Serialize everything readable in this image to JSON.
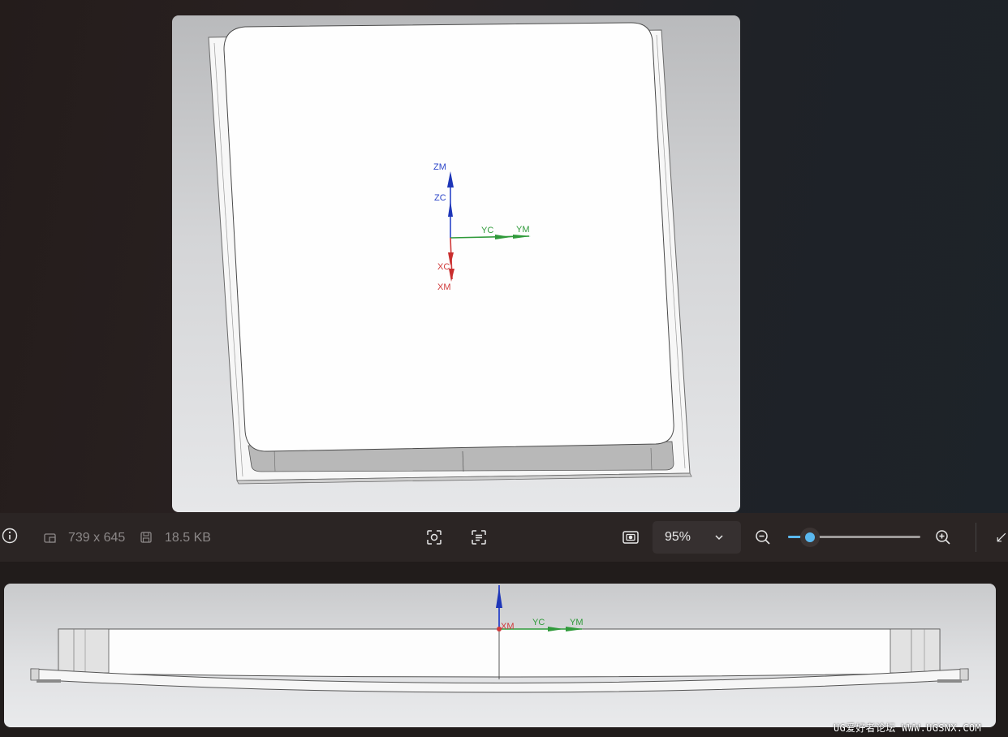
{
  "image_info": {
    "dimensions": "739 x 645",
    "file_size": "18.5 KB"
  },
  "zoom": {
    "value": "95%",
    "level_percent": 95
  },
  "main_view_axes": {
    "zm": "ZM",
    "zc": "ZC",
    "yc": "YC",
    "ym": "YM",
    "xc": "XC",
    "xm": "XM"
  },
  "thumb_view_axes": {
    "xm": "XM",
    "yc": "YC",
    "ym": "YM"
  },
  "watermark": "UG爱好者论坛 WWW.UGSNX.COM",
  "icons": {
    "info": "info-icon",
    "dimensions": "image-size-icon",
    "file_size": "save-disk-icon",
    "visual_search": "visual-search-icon",
    "ocr": "text-recognition-icon",
    "fit": "fit-to-window-icon",
    "zoom_dropdown": "chevron-down-icon",
    "zoom_out": "zoom-out-icon",
    "zoom_in": "zoom-in-icon",
    "fullscreen": "expand-icon"
  },
  "colors": {
    "accent": "#5ab8ef",
    "axis_x": "#d03a3a",
    "axis_y": "#2f9a3a",
    "axis_z": "#2a44c8"
  }
}
